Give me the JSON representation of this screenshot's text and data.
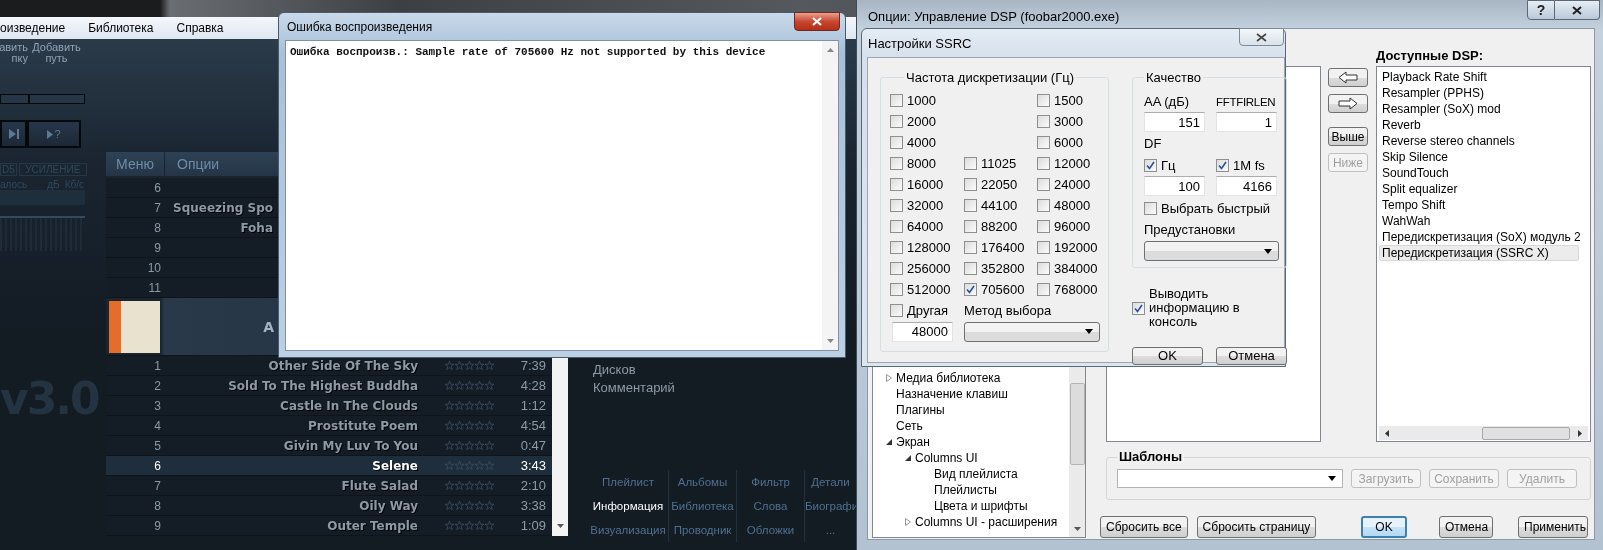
{
  "player": {
    "menu": [
      "оизведение",
      "Библиотека",
      "Справка"
    ],
    "toolbar_buttons": [
      {
        "lines": [
          "авить",
          "пку"
        ]
      },
      {
        "lines": [
          "Добавить",
          "путь"
        ]
      }
    ],
    "transport": [
      {
        "kind": "next"
      },
      {
        "kind": "random",
        "label": "?"
      }
    ],
    "meter_labels": [
      "D5",
      "УСИЛЕНИЕ"
    ],
    "meter_units": [
      "алось",
      "дБ",
      "Кб/с"
    ],
    "logo": "v3.0",
    "header": [
      "Меню",
      "Опции"
    ],
    "top_rows": [
      {
        "number": "6",
        "selected": false
      },
      {
        "number": "7",
        "title": "Squeezing Spo",
        "selected": false
      },
      {
        "number": "8",
        "title": "Foha",
        "selected": false
      },
      {
        "number": "9",
        "selected": false
      },
      {
        "number": "10",
        "selected": false
      },
      {
        "number": "11",
        "selected": false
      }
    ],
    "album": {
      "title": "A"
    },
    "tracks": [
      {
        "number": "1",
        "title": "Other Side Of The Sky",
        "stars": 0,
        "duration": "7:39",
        "selected": false
      },
      {
        "number": "2",
        "title": "Sold To The Highest Buddha",
        "stars": 0,
        "duration": "4:28",
        "selected": false
      },
      {
        "number": "3",
        "title": "Castle In The Clouds",
        "stars": 0,
        "duration": "1:12",
        "selected": false
      },
      {
        "number": "4",
        "title": "Prostitute Poem",
        "stars": 0,
        "duration": "4:54",
        "selected": false
      },
      {
        "number": "5",
        "title": "Givin My Luv To You",
        "stars": 0,
        "duration": "0:47",
        "selected": false
      },
      {
        "number": "6",
        "title": "Selene",
        "stars": 0,
        "duration": "3:43",
        "selected": true
      },
      {
        "number": "7",
        "title": "Flute Salad",
        "stars": 0,
        "duration": "2:10",
        "selected": false
      },
      {
        "number": "8",
        "title": "Oily Way",
        "stars": 0,
        "duration": "3:38",
        "selected": false
      },
      {
        "number": "9",
        "title": "Outer Temple",
        "stars": 0,
        "duration": "1:09",
        "selected": false
      }
    ],
    "info_labels": [
      "Дисков",
      "Комментарий"
    ],
    "tabs": [
      {
        "label": "Плейлист",
        "selected": false
      },
      {
        "label": "Альбомы",
        "selected": false
      },
      {
        "label": "Фильтр",
        "selected": false
      },
      {
        "label": "Детали",
        "selected": false
      },
      {
        "label": "Информация",
        "selected": true
      },
      {
        "label": "Библиотека",
        "selected": false
      },
      {
        "label": "Слова",
        "selected": false
      },
      {
        "label": "Биографи",
        "selected": false
      },
      {
        "label": "Визуализация",
        "selected": false
      },
      {
        "label": "Проводник",
        "selected": false
      },
      {
        "label": "Обложки",
        "selected": false
      },
      {
        "label": "...",
        "selected": false
      }
    ]
  },
  "error_dialog": {
    "title": "Ошибка воспроизведения",
    "message": "Ошибка воспроизв.: Sample rate of 705600 Hz not supported by this device"
  },
  "dsp_window": {
    "title": "Опции: Управление DSP (foobar2000.exe)",
    "help": "?",
    "tree": [
      {
        "label": "Медиа библиотека",
        "expanded": false
      },
      {
        "label": "Назначение клавиш"
      },
      {
        "label": "Плагины"
      },
      {
        "label": "Сеть"
      },
      {
        "label": "Экран",
        "expanded": true,
        "children": [
          {
            "label": "Columns UI",
            "expanded": true,
            "children": [
              {
                "label": "Вид плейлиста"
              },
              {
                "label": "Плейлисты"
              },
              {
                "label": "Цвета и шрифты"
              }
            ]
          },
          {
            "label": "Columns UI - расширения",
            "expanded": false
          }
        ]
      }
    ],
    "move_buttons": [
      {
        "kind": "left",
        "disabled": false
      },
      {
        "kind": "right",
        "disabled": false
      },
      {
        "kind": "text",
        "label": "Выше",
        "disabled": false
      },
      {
        "kind": "text",
        "label": "Ниже",
        "disabled": true
      }
    ],
    "available_label": "Доступные DSP:",
    "available": [
      {
        "label": "Playback Rate Shift",
        "selected": false
      },
      {
        "label": "Resampler (PPHS)",
        "selected": false
      },
      {
        "label": "Resampler (SoX) mod",
        "selected": false
      },
      {
        "label": "Reverb",
        "selected": false
      },
      {
        "label": "Reverse stereo channels",
        "selected": false
      },
      {
        "label": "Skip Silence",
        "selected": false
      },
      {
        "label": "SoundTouch",
        "selected": false
      },
      {
        "label": "Split equalizer",
        "selected": false
      },
      {
        "label": "Tempo Shift",
        "selected": false
      },
      {
        "label": "WahWah",
        "selected": false
      },
      {
        "label": "Передискретизация (SoX) модуль 2",
        "selected": false
      },
      {
        "label": "Передискретизация (SSRC X)",
        "selected": true
      }
    ],
    "presets": {
      "label": "Шаблоны",
      "buttons": [
        {
          "label": "Загрузить",
          "disabled": true
        },
        {
          "label": "Сохранить",
          "disabled": true
        },
        {
          "label": "Удалить",
          "disabled": true
        }
      ]
    },
    "buttons": [
      {
        "label": "Сбросить все",
        "default": false
      },
      {
        "label": "Сбросить страницу",
        "default": false
      },
      {
        "label": "OK",
        "default": true
      },
      {
        "label": "Отмена",
        "default": false
      },
      {
        "label": "Применить",
        "default": false
      }
    ]
  },
  "ssrc_dialog": {
    "title": "Настройки SSRC",
    "rates_label": "Частота дискретизации (Гц)",
    "rates": [
      {
        "left": {
          "label": "1000",
          "checked": false
        },
        "right": {
          "label": "1500",
          "checked": false
        }
      },
      {
        "left": {
          "label": "2000",
          "checked": false
        },
        "right": {
          "label": "3000",
          "checked": false
        }
      },
      {
        "left": {
          "label": "4000",
          "checked": false
        },
        "right": {
          "label": "6000",
          "checked": false
        }
      },
      {
        "left": {
          "label": "8000",
          "checked": false
        },
        "middle": {
          "label": "11025",
          "checked": false
        },
        "right": {
          "label": "12000",
          "checked": false
        }
      },
      {
        "left": {
          "label": "16000",
          "checked": false
        },
        "middle": {
          "label": "22050",
          "checked": false
        },
        "right": {
          "label": "24000",
          "checked": false
        }
      },
      {
        "left": {
          "label": "32000",
          "checked": false
        },
        "middle": {
          "label": "44100",
          "checked": false
        },
        "right": {
          "label": "48000",
          "checked": false
        }
      },
      {
        "left": {
          "label": "64000",
          "checked": false
        },
        "middle": {
          "label": "88200",
          "checked": false
        },
        "right": {
          "label": "96000",
          "checked": false
        }
      },
      {
        "left": {
          "label": "128000",
          "checked": false
        },
        "middle": {
          "label": "176400",
          "checked": false
        },
        "right": {
          "label": "192000",
          "checked": false
        }
      },
      {
        "left": {
          "label": "256000",
          "checked": false
        },
        "middle": {
          "label": "352800",
          "checked": false
        },
        "right": {
          "label": "384000",
          "checked": false
        }
      },
      {
        "left": {
          "label": "512000",
          "checked": false
        },
        "middle": {
          "label": "705600",
          "checked": true
        },
        "right": {
          "label": "768000",
          "checked": false
        }
      }
    ],
    "other": {
      "label": "Другая",
      "checked": false,
      "value": "48000"
    },
    "method_label": "Метод выбора",
    "quality": {
      "label": "Качество",
      "aa_label": "AA (дБ)",
      "aa": "151",
      "fft_label": "FFTFIRLEN",
      "fft": "1",
      "df_label": "DF",
      "hz": {
        "label": "Гц",
        "checked": true,
        "value": "100"
      },
      "fs": {
        "label": "1M fs",
        "checked": true,
        "value": "4166"
      },
      "fast": {
        "label": "Выбрать быстрый",
        "checked": false
      },
      "presets_label": "Предустановки"
    },
    "console": {
      "label": "Выводить информацию в консоль",
      "checked": true
    },
    "buttons": [
      "OK",
      "Отмена"
    ]
  }
}
